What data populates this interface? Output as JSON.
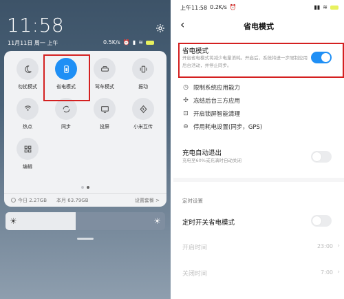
{
  "left": {
    "time": "11:58",
    "date": "11月11日 周一 上午",
    "net_speed": "0.5K/s",
    "tiles": [
      {
        "label": "勿扰模式",
        "icon": "moon-icon"
      },
      {
        "label": "省电模式",
        "icon": "battery-saver-icon",
        "active": true
      },
      {
        "label": "驾车模式",
        "icon": "car-icon"
      },
      {
        "label": "振动",
        "icon": "vibrate-icon"
      },
      {
        "label": "热点",
        "icon": "hotspot-icon"
      },
      {
        "label": "同步",
        "icon": "sync-icon"
      },
      {
        "label": "投屏",
        "icon": "cast-icon"
      },
      {
        "label": "小米互传",
        "icon": "share-icon"
      },
      {
        "label": "编辑",
        "icon": "edit-grid-icon"
      }
    ],
    "footer": {
      "today": "今日 2.27GB",
      "month": "本月 63.79GB",
      "settings": "设置套餐 >"
    },
    "brightness": 0.44
  },
  "right": {
    "status_time": "上午11:58",
    "status_speed": "0.2K/s",
    "title": "省电模式",
    "main_title": "省电模式",
    "main_desc": "开启省电模式将减少电量消耗。开启后，系统将进一步限制应用后台活动，并停止同步。",
    "main_on": true,
    "features": [
      {
        "label": "限制系统应用能力",
        "icon": "clock-icon"
      },
      {
        "label": "冻结后台三方应用",
        "icon": "freeze-icon"
      },
      {
        "label": "开启锁屏智能清理",
        "icon": "lock-clean-icon"
      },
      {
        "label": "停用耗电设置(同步，GPS)",
        "icon": "minus-circle-icon"
      }
    ],
    "auto_exit_title": "充电自动退出",
    "auto_exit_desc": "充电至60%或充满时自动关闭",
    "auto_exit_on": false,
    "schedule_section": "定时设置",
    "scheduled_title": "定时开关省电模式",
    "scheduled_on": false,
    "start_label": "开启时间",
    "start_value": "23:00",
    "end_label": "关闭时间",
    "end_value": "7:00"
  },
  "colors": {
    "accent": "#1f8ff5",
    "highlight": "#d42020"
  }
}
